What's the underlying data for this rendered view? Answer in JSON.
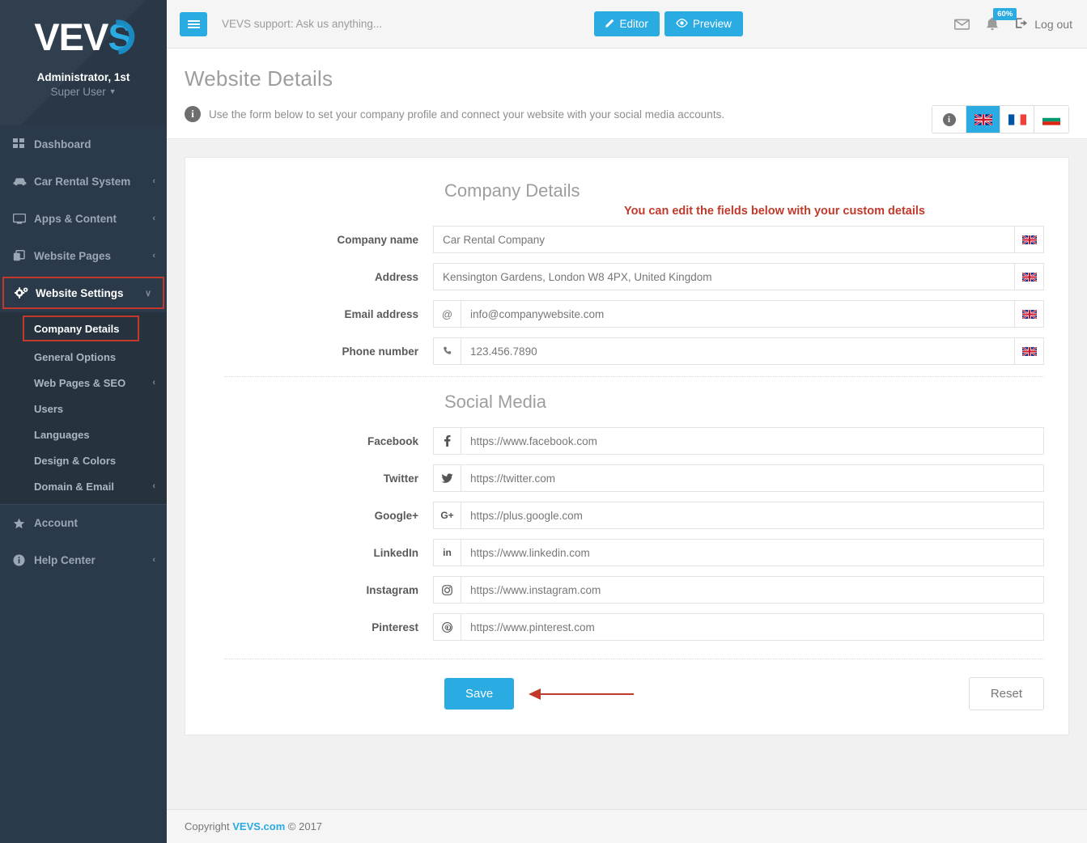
{
  "sidebar": {
    "logo_text": "VEV",
    "logo_accent": "S",
    "user_name": "Administrator, 1st",
    "user_role": "Super User",
    "items": [
      {
        "label": "Dashboard",
        "icon": "grid-icon",
        "arrow": ""
      },
      {
        "label": "Car Rental System",
        "icon": "car-icon",
        "arrow": "‹"
      },
      {
        "label": "Apps & Content",
        "icon": "monitor-icon",
        "arrow": "‹"
      },
      {
        "label": "Website Pages",
        "icon": "pages-icon",
        "arrow": "‹"
      },
      {
        "label": "Website Settings",
        "icon": "gears-icon",
        "arrow": "∨"
      },
      {
        "label": "Account",
        "icon": "star-icon",
        "arrow": ""
      },
      {
        "label": "Help Center",
        "icon": "info-icon",
        "arrow": "‹"
      }
    ],
    "sub_items": [
      {
        "label": "Company Details",
        "arrow": ""
      },
      {
        "label": "General Options",
        "arrow": ""
      },
      {
        "label": "Web Pages & SEO",
        "arrow": "‹"
      },
      {
        "label": "Users",
        "arrow": ""
      },
      {
        "label": "Languages",
        "arrow": ""
      },
      {
        "label": "Design & Colors",
        "arrow": ""
      },
      {
        "label": "Domain & Email",
        "arrow": "‹"
      }
    ]
  },
  "topbar": {
    "menu_toggle": "hamburger-icon",
    "support_text": "VEVS support: Ask us anything...",
    "editor_label": "Editor",
    "preview_label": "Preview",
    "mail_icon": "envelope-icon",
    "bell_icon": "bell-icon",
    "notification_badge": "60%",
    "logout_label": "Log out"
  },
  "page": {
    "title": "Website Details",
    "description": "Use the form below to set your company profile and connect your website with your social media accounts.",
    "info_icon": "info-icon",
    "languages": [
      {
        "name": "info",
        "type": "info",
        "active": false
      },
      {
        "name": "English",
        "type": "uk",
        "active": true
      },
      {
        "name": "French",
        "type": "fr",
        "active": false
      },
      {
        "name": "Bulgarian",
        "type": "bg",
        "active": false
      }
    ]
  },
  "company": {
    "section_title": "Company Details",
    "hint": "You can edit the fields below with your custom details",
    "fields": [
      {
        "label": "Company name",
        "value": "Car Rental Company",
        "addon": "",
        "addon_name": "none",
        "flag": "uk"
      },
      {
        "label": "Address",
        "value": "Kensington Gardens, London W8 4PX, United Kingdom",
        "addon": "",
        "addon_name": "none",
        "flag": "uk"
      },
      {
        "label": "Email address",
        "value": "info@companywebsite.com",
        "addon": "@",
        "addon_name": "at-sign-icon",
        "flag": "uk"
      },
      {
        "label": "Phone number",
        "value": "123.456.7890",
        "addon": "✆",
        "addon_name": "phone-icon",
        "flag": "uk"
      }
    ]
  },
  "social": {
    "section_title": "Social Media",
    "fields": [
      {
        "label": "Facebook",
        "value": "https://www.facebook.com",
        "addon": "f",
        "addon_name": "facebook-icon"
      },
      {
        "label": "Twitter",
        "value": "https://twitter.com",
        "addon": "ᵛ",
        "addon_name": "twitter-icon"
      },
      {
        "label": "Google+",
        "value": "https://plus.google.com",
        "addon": "G+",
        "addon_name": "google-plus-icon"
      },
      {
        "label": "LinkedIn",
        "value": "https://www.linkedin.com",
        "addon": "in",
        "addon_name": "linkedin-icon"
      },
      {
        "label": "Instagram",
        "value": "https://www.instagram.com",
        "addon": "□",
        "addon_name": "instagram-icon"
      },
      {
        "label": "Pinterest",
        "value": "https://www.pinterest.com",
        "addon": "P",
        "addon_name": "pinterest-icon"
      }
    ]
  },
  "actions": {
    "save_label": "Save",
    "reset_label": "Reset",
    "arrow_annotation": "red-arrow-pointing-to-save"
  },
  "footer": {
    "copyright_prefix": "Copyright",
    "link": "VEVS.com",
    "copyright_suffix": "© 2017"
  },
  "colors": {
    "accent": "#2aabe2",
    "sidebar": "#2b3a4a",
    "sidebar_sub": "#26333f",
    "highlight_red": "#c0392b",
    "page_bg": "#f1f1f1"
  }
}
